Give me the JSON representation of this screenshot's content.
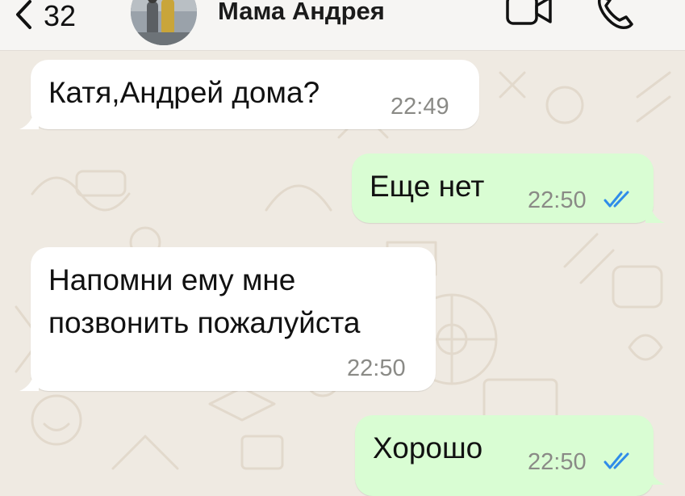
{
  "header": {
    "back_count": "32",
    "contact_name": "Мама Андрея"
  },
  "messages": [
    {
      "direction": "incoming",
      "text": "Катя,Андрей дома?",
      "time": "22:49"
    },
    {
      "direction": "outgoing",
      "text": "Еще нет",
      "time": "22:50",
      "status": "read"
    },
    {
      "direction": "incoming",
      "lines": [
        "Напомни ему мне",
        "позвонить пожалуйста"
      ],
      "time": "22:50"
    },
    {
      "direction": "outgoing",
      "text": "Хорошо",
      "time": "22:50",
      "status": "read"
    }
  ],
  "icons": {
    "back": "chevron-left-icon",
    "video": "video-camera-icon",
    "call": "phone-icon",
    "read_status": "double-check-icon"
  },
  "colors": {
    "wallpaper": "#efeae2",
    "header": "#f6f5f3",
    "incoming_bubble": "#ffffff",
    "outgoing_bubble": "#d9fdd3",
    "read_ticks": "#2f8ce9"
  }
}
